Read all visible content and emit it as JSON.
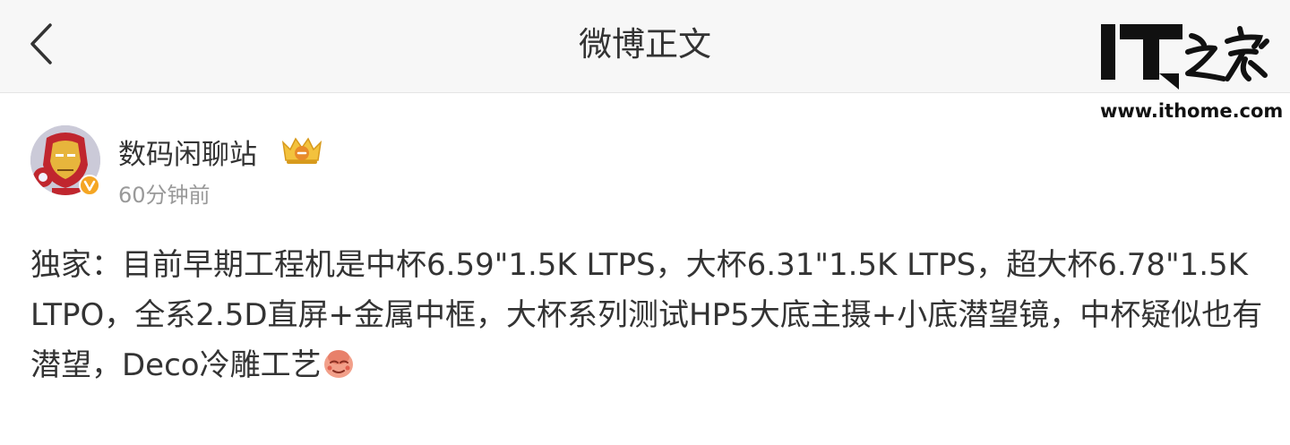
{
  "nav": {
    "title": "微博正文",
    "back_icon": "chevron-left-icon"
  },
  "watermark": {
    "logo_text": "IT之家",
    "url": "www.ithome.com"
  },
  "author": {
    "name": "数码闲聊站",
    "time": "60分钟前",
    "avatar_icon": "iron-man-avatar",
    "verified_icon": "verified-v-icon",
    "member_badge_icon": "crown-member-icon"
  },
  "post": {
    "text": "独家：目前早期工程机是中杯6.59\"1.5K LTPS，大杯6.31\"1.5K LTPS，超大杯6.78\"1.5K LTPO，全系2.5D直屏+金属中框，大杯系列测试HP5大底主摄+小底潜望镜，中杯疑似也有潜望，Deco冷雕工艺",
    "emoji_icon": "smirk-emoji-icon"
  },
  "colors": {
    "nav_background": "#f7f7f7",
    "text_primary": "#333333",
    "text_secondary": "#999999",
    "verified_orange": "#f5a623"
  }
}
